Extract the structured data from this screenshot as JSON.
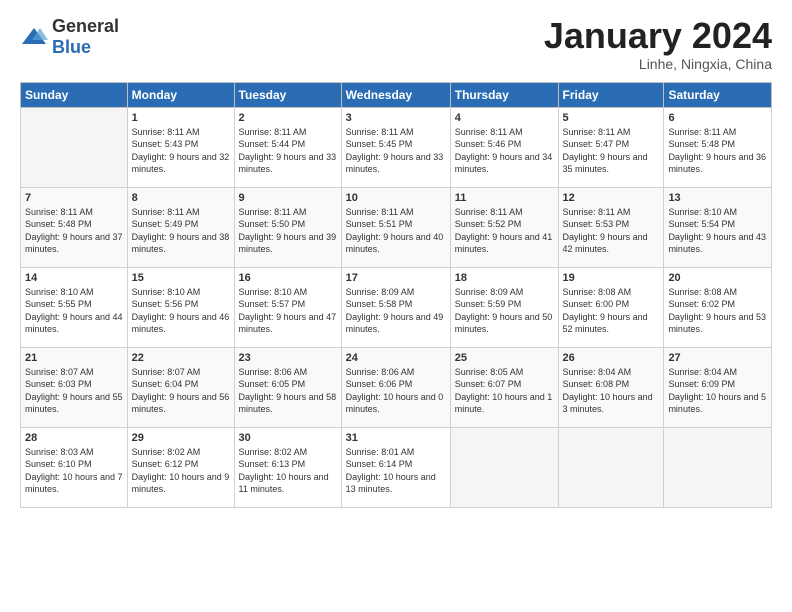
{
  "header": {
    "logo_general": "General",
    "logo_blue": "Blue",
    "month_title": "January 2024",
    "location": "Linhe, Ningxia, China"
  },
  "days_of_week": [
    "Sunday",
    "Monday",
    "Tuesday",
    "Wednesday",
    "Thursday",
    "Friday",
    "Saturday"
  ],
  "weeks": [
    [
      {
        "day": "",
        "sunrise": "",
        "sunset": "",
        "daylight": ""
      },
      {
        "day": "1",
        "sunrise": "Sunrise: 8:11 AM",
        "sunset": "Sunset: 5:43 PM",
        "daylight": "Daylight: 9 hours and 32 minutes."
      },
      {
        "day": "2",
        "sunrise": "Sunrise: 8:11 AM",
        "sunset": "Sunset: 5:44 PM",
        "daylight": "Daylight: 9 hours and 33 minutes."
      },
      {
        "day": "3",
        "sunrise": "Sunrise: 8:11 AM",
        "sunset": "Sunset: 5:45 PM",
        "daylight": "Daylight: 9 hours and 33 minutes."
      },
      {
        "day": "4",
        "sunrise": "Sunrise: 8:11 AM",
        "sunset": "Sunset: 5:46 PM",
        "daylight": "Daylight: 9 hours and 34 minutes."
      },
      {
        "day": "5",
        "sunrise": "Sunrise: 8:11 AM",
        "sunset": "Sunset: 5:47 PM",
        "daylight": "Daylight: 9 hours and 35 minutes."
      },
      {
        "day": "6",
        "sunrise": "Sunrise: 8:11 AM",
        "sunset": "Sunset: 5:48 PM",
        "daylight": "Daylight: 9 hours and 36 minutes."
      }
    ],
    [
      {
        "day": "7",
        "sunrise": "Sunrise: 8:11 AM",
        "sunset": "Sunset: 5:48 PM",
        "daylight": "Daylight: 9 hours and 37 minutes."
      },
      {
        "day": "8",
        "sunrise": "Sunrise: 8:11 AM",
        "sunset": "Sunset: 5:49 PM",
        "daylight": "Daylight: 9 hours and 38 minutes."
      },
      {
        "day": "9",
        "sunrise": "Sunrise: 8:11 AM",
        "sunset": "Sunset: 5:50 PM",
        "daylight": "Daylight: 9 hours and 39 minutes."
      },
      {
        "day": "10",
        "sunrise": "Sunrise: 8:11 AM",
        "sunset": "Sunset: 5:51 PM",
        "daylight": "Daylight: 9 hours and 40 minutes."
      },
      {
        "day": "11",
        "sunrise": "Sunrise: 8:11 AM",
        "sunset": "Sunset: 5:52 PM",
        "daylight": "Daylight: 9 hours and 41 minutes."
      },
      {
        "day": "12",
        "sunrise": "Sunrise: 8:11 AM",
        "sunset": "Sunset: 5:53 PM",
        "daylight": "Daylight: 9 hours and 42 minutes."
      },
      {
        "day": "13",
        "sunrise": "Sunrise: 8:10 AM",
        "sunset": "Sunset: 5:54 PM",
        "daylight": "Daylight: 9 hours and 43 minutes."
      }
    ],
    [
      {
        "day": "14",
        "sunrise": "Sunrise: 8:10 AM",
        "sunset": "Sunset: 5:55 PM",
        "daylight": "Daylight: 9 hours and 44 minutes."
      },
      {
        "day": "15",
        "sunrise": "Sunrise: 8:10 AM",
        "sunset": "Sunset: 5:56 PM",
        "daylight": "Daylight: 9 hours and 46 minutes."
      },
      {
        "day": "16",
        "sunrise": "Sunrise: 8:10 AM",
        "sunset": "Sunset: 5:57 PM",
        "daylight": "Daylight: 9 hours and 47 minutes."
      },
      {
        "day": "17",
        "sunrise": "Sunrise: 8:09 AM",
        "sunset": "Sunset: 5:58 PM",
        "daylight": "Daylight: 9 hours and 49 minutes."
      },
      {
        "day": "18",
        "sunrise": "Sunrise: 8:09 AM",
        "sunset": "Sunset: 5:59 PM",
        "daylight": "Daylight: 9 hours and 50 minutes."
      },
      {
        "day": "19",
        "sunrise": "Sunrise: 8:08 AM",
        "sunset": "Sunset: 6:00 PM",
        "daylight": "Daylight: 9 hours and 52 minutes."
      },
      {
        "day": "20",
        "sunrise": "Sunrise: 8:08 AM",
        "sunset": "Sunset: 6:02 PM",
        "daylight": "Daylight: 9 hours and 53 minutes."
      }
    ],
    [
      {
        "day": "21",
        "sunrise": "Sunrise: 8:07 AM",
        "sunset": "Sunset: 6:03 PM",
        "daylight": "Daylight: 9 hours and 55 minutes."
      },
      {
        "day": "22",
        "sunrise": "Sunrise: 8:07 AM",
        "sunset": "Sunset: 6:04 PM",
        "daylight": "Daylight: 9 hours and 56 minutes."
      },
      {
        "day": "23",
        "sunrise": "Sunrise: 8:06 AM",
        "sunset": "Sunset: 6:05 PM",
        "daylight": "Daylight: 9 hours and 58 minutes."
      },
      {
        "day": "24",
        "sunrise": "Sunrise: 8:06 AM",
        "sunset": "Sunset: 6:06 PM",
        "daylight": "Daylight: 10 hours and 0 minutes."
      },
      {
        "day": "25",
        "sunrise": "Sunrise: 8:05 AM",
        "sunset": "Sunset: 6:07 PM",
        "daylight": "Daylight: 10 hours and 1 minute."
      },
      {
        "day": "26",
        "sunrise": "Sunrise: 8:04 AM",
        "sunset": "Sunset: 6:08 PM",
        "daylight": "Daylight: 10 hours and 3 minutes."
      },
      {
        "day": "27",
        "sunrise": "Sunrise: 8:04 AM",
        "sunset": "Sunset: 6:09 PM",
        "daylight": "Daylight: 10 hours and 5 minutes."
      }
    ],
    [
      {
        "day": "28",
        "sunrise": "Sunrise: 8:03 AM",
        "sunset": "Sunset: 6:10 PM",
        "daylight": "Daylight: 10 hours and 7 minutes."
      },
      {
        "day": "29",
        "sunrise": "Sunrise: 8:02 AM",
        "sunset": "Sunset: 6:12 PM",
        "daylight": "Daylight: 10 hours and 9 minutes."
      },
      {
        "day": "30",
        "sunrise": "Sunrise: 8:02 AM",
        "sunset": "Sunset: 6:13 PM",
        "daylight": "Daylight: 10 hours and 11 minutes."
      },
      {
        "day": "31",
        "sunrise": "Sunrise: 8:01 AM",
        "sunset": "Sunset: 6:14 PM",
        "daylight": "Daylight: 10 hours and 13 minutes."
      },
      {
        "day": "",
        "sunrise": "",
        "sunset": "",
        "daylight": ""
      },
      {
        "day": "",
        "sunrise": "",
        "sunset": "",
        "daylight": ""
      },
      {
        "day": "",
        "sunrise": "",
        "sunset": "",
        "daylight": ""
      }
    ]
  ]
}
